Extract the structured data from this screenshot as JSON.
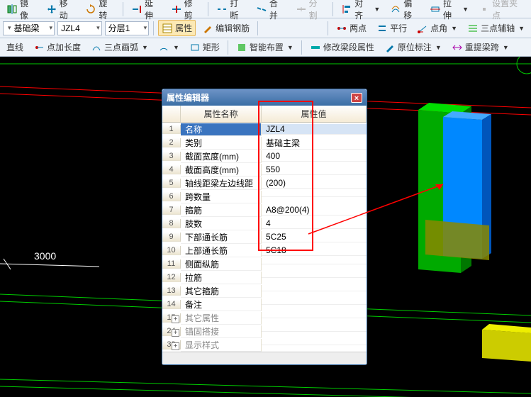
{
  "toolbar1": {
    "items": [
      {
        "label": "镜像",
        "icon": "mirror"
      },
      {
        "label": "移动",
        "icon": "move"
      },
      {
        "label": "旋转",
        "icon": "rotate"
      },
      {
        "label": "延伸",
        "icon": "extend"
      },
      {
        "label": "修剪",
        "icon": "trim"
      },
      {
        "label": "打断",
        "icon": "break"
      },
      {
        "label": "合并",
        "icon": "merge"
      },
      {
        "label": "分割",
        "icon": "split",
        "disabled": true
      },
      {
        "label": "对齐",
        "icon": "align"
      },
      {
        "label": "偏移",
        "icon": "offset"
      },
      {
        "label": "拉伸",
        "icon": "stretch"
      },
      {
        "label": "设置夹点",
        "icon": "grip",
        "disabled": true
      }
    ]
  },
  "toolbar2": {
    "dd_category": "基础梁",
    "dd_name": "JZL4",
    "dd_layer": "分层1",
    "btn_props": "属性",
    "btn_editrebar": "编辑钢筋",
    "btn_twopoint": "两点",
    "btn_parallel": "平行",
    "btn_pointangle": "点角",
    "btn_threepoint": "三点辅轴"
  },
  "toolbar3": {
    "btn_line": "直线",
    "btn_addlen": "点加长度",
    "btn_threearc": "三点画弧",
    "btn_rect": "矩形",
    "btn_smart": "智能布置",
    "btn_modifyseg": "修改梁段属性",
    "btn_origmark": "原位标注",
    "btn_respan": "重提梁跨"
  },
  "dialog": {
    "title": "属性编辑器",
    "col_name": "属性名称",
    "col_value": "属性值",
    "rows": [
      {
        "n": "1",
        "name": "名称",
        "value": "JZL4",
        "selected": true
      },
      {
        "n": "2",
        "name": "类别",
        "value": "基础主梁"
      },
      {
        "n": "3",
        "name": "截面宽度(mm)",
        "value": "400"
      },
      {
        "n": "4",
        "name": "截面高度(mm)",
        "value": "550"
      },
      {
        "n": "5",
        "name": "轴线距梁左边线距",
        "value": "(200)"
      },
      {
        "n": "6",
        "name": "跨数量",
        "value": ""
      },
      {
        "n": "7",
        "name": "箍筋",
        "value": "A8@200(4)"
      },
      {
        "n": "8",
        "name": "肢数",
        "value": "4"
      },
      {
        "n": "9",
        "name": "下部通长筋",
        "value": "5C25"
      },
      {
        "n": "10",
        "name": "上部通长筋",
        "value": "5C18"
      },
      {
        "n": "11",
        "name": "侧面纵筋",
        "value": ""
      },
      {
        "n": "12",
        "name": "拉筋",
        "value": ""
      },
      {
        "n": "13",
        "name": "其它箍筋",
        "value": ""
      },
      {
        "n": "14",
        "name": "备注",
        "value": ""
      },
      {
        "n": "15",
        "name": "其它属性",
        "value": "",
        "group": true
      },
      {
        "n": "24",
        "name": "锚固搭接",
        "value": "",
        "group": true
      },
      {
        "n": "39",
        "name": "显示样式",
        "value": "",
        "group": true
      }
    ]
  },
  "canvas": {
    "dim_label": "3000"
  }
}
